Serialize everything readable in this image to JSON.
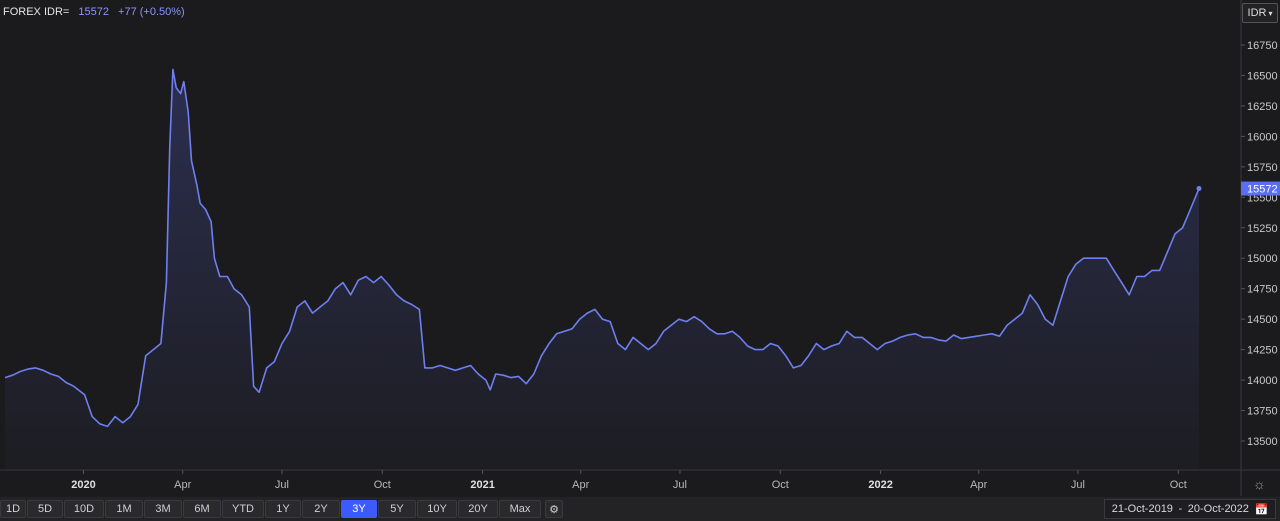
{
  "header": {
    "symbol": "FOREX IDR=",
    "price": "15572",
    "change": "+77 (+0.50%)",
    "currency": "IDR"
  },
  "colors": {
    "line": "#6e7ff0",
    "area_top": "#3a3f7a",
    "active": "#3d5afe"
  },
  "ranges": [
    "1D",
    "5D",
    "10D",
    "1M",
    "3M",
    "6M",
    "YTD",
    "1Y",
    "2Y",
    "3Y",
    "5Y",
    "10Y",
    "20Y",
    "Max"
  ],
  "active_range": "3Y",
  "date_range": {
    "start": "21-Oct-2019",
    "sep": "-",
    "end": "20-Oct-2022"
  },
  "icons": {
    "settings": "gear-icon",
    "calendar": "calendar-icon",
    "chart_settings": "sun-gear-icon"
  },
  "chart_data": {
    "type": "area",
    "title": "",
    "xlabel": "",
    "ylabel": "",
    "y_ticks": [
      13500,
      13750,
      14000,
      14250,
      14500,
      14750,
      15000,
      15250,
      15500,
      15750,
      16000,
      16250,
      16500,
      16750
    ],
    "y_range": [
      13300,
      16800
    ],
    "x_range": [
      "2019-10-21",
      "2022-10-20"
    ],
    "x_ticks": [
      {
        "date": "2020-01-01",
        "label": "2020",
        "major": true
      },
      {
        "date": "2020-04-01",
        "label": "Apr",
        "major": false
      },
      {
        "date": "2020-07-01",
        "label": "Jul",
        "major": false
      },
      {
        "date": "2020-10-01",
        "label": "Oct",
        "major": false
      },
      {
        "date": "2021-01-01",
        "label": "2021",
        "major": true
      },
      {
        "date": "2021-04-01",
        "label": "Apr",
        "major": false
      },
      {
        "date": "2021-07-01",
        "label": "Jul",
        "major": false
      },
      {
        "date": "2021-10-01",
        "label": "Oct",
        "major": false
      },
      {
        "date": "2022-01-01",
        "label": "2022",
        "major": true
      },
      {
        "date": "2022-04-01",
        "label": "Apr",
        "major": false
      },
      {
        "date": "2022-07-01",
        "label": "Jul",
        "major": false
      },
      {
        "date": "2022-10-01",
        "label": "Oct",
        "major": false
      }
    ],
    "last_value_label": "15572",
    "series": [
      {
        "values": [
          [
            "2019-10-21",
            14020
          ],
          [
            "2019-10-28",
            14040
          ],
          [
            "2019-11-04",
            14070
          ],
          [
            "2019-11-11",
            14090
          ],
          [
            "2019-11-18",
            14100
          ],
          [
            "2019-11-25",
            14080
          ],
          [
            "2019-12-02",
            14050
          ],
          [
            "2019-12-09",
            14030
          ],
          [
            "2019-12-16",
            13980
          ],
          [
            "2019-12-23",
            13950
          ],
          [
            "2020-01-02",
            13880
          ],
          [
            "2020-01-09",
            13700
          ],
          [
            "2020-01-16",
            13640
          ],
          [
            "2020-01-23",
            13620
          ],
          [
            "2020-01-30",
            13700
          ],
          [
            "2020-02-06",
            13650
          ],
          [
            "2020-02-13",
            13700
          ],
          [
            "2020-02-20",
            13800
          ],
          [
            "2020-02-27",
            14200
          ],
          [
            "2020-03-05",
            14250
          ],
          [
            "2020-03-12",
            14300
          ],
          [
            "2020-03-17",
            14800
          ],
          [
            "2020-03-20",
            15900
          ],
          [
            "2020-03-23",
            16550
          ],
          [
            "2020-03-26",
            16400
          ],
          [
            "2020-03-30",
            16350
          ],
          [
            "2020-04-02",
            16450
          ],
          [
            "2020-04-06",
            16200
          ],
          [
            "2020-04-09",
            15800
          ],
          [
            "2020-04-14",
            15600
          ],
          [
            "2020-04-17",
            15450
          ],
          [
            "2020-04-22",
            15400
          ],
          [
            "2020-04-27",
            15300
          ],
          [
            "2020-04-30",
            15000
          ],
          [
            "2020-05-05",
            14850
          ],
          [
            "2020-05-12",
            14850
          ],
          [
            "2020-05-18",
            14750
          ],
          [
            "2020-05-25",
            14700
          ],
          [
            "2020-06-01",
            14600
          ],
          [
            "2020-06-05",
            13950
          ],
          [
            "2020-06-10",
            13900
          ],
          [
            "2020-06-17",
            14100
          ],
          [
            "2020-06-24",
            14150
          ],
          [
            "2020-07-01",
            14300
          ],
          [
            "2020-07-08",
            14400
          ],
          [
            "2020-07-15",
            14600
          ],
          [
            "2020-07-22",
            14650
          ],
          [
            "2020-07-29",
            14550
          ],
          [
            "2020-08-05",
            14600
          ],
          [
            "2020-08-12",
            14650
          ],
          [
            "2020-08-19",
            14750
          ],
          [
            "2020-08-26",
            14800
          ],
          [
            "2020-09-02",
            14700
          ],
          [
            "2020-09-09",
            14820
          ],
          [
            "2020-09-16",
            14850
          ],
          [
            "2020-09-23",
            14800
          ],
          [
            "2020-09-30",
            14850
          ],
          [
            "2020-10-07",
            14780
          ],
          [
            "2020-10-14",
            14700
          ],
          [
            "2020-10-21",
            14650
          ],
          [
            "2020-10-28",
            14620
          ],
          [
            "2020-11-04",
            14580
          ],
          [
            "2020-11-09",
            14100
          ],
          [
            "2020-11-16",
            14100
          ],
          [
            "2020-11-23",
            14120
          ],
          [
            "2020-11-30",
            14100
          ],
          [
            "2020-12-07",
            14080
          ],
          [
            "2020-12-14",
            14100
          ],
          [
            "2020-12-21",
            14120
          ],
          [
            "2020-12-28",
            14050
          ],
          [
            "2021-01-04",
            14000
          ],
          [
            "2021-01-08",
            13920
          ],
          [
            "2021-01-13",
            14050
          ],
          [
            "2021-01-20",
            14040
          ],
          [
            "2021-01-27",
            14020
          ],
          [
            "2021-02-03",
            14030
          ],
          [
            "2021-02-10",
            13970
          ],
          [
            "2021-02-17",
            14050
          ],
          [
            "2021-02-24",
            14200
          ],
          [
            "2021-03-03",
            14300
          ],
          [
            "2021-03-10",
            14380
          ],
          [
            "2021-03-17",
            14400
          ],
          [
            "2021-03-24",
            14420
          ],
          [
            "2021-03-31",
            14500
          ],
          [
            "2021-04-07",
            14550
          ],
          [
            "2021-04-14",
            14580
          ],
          [
            "2021-04-21",
            14500
          ],
          [
            "2021-04-28",
            14480
          ],
          [
            "2021-05-05",
            14300
          ],
          [
            "2021-05-12",
            14250
          ],
          [
            "2021-05-19",
            14350
          ],
          [
            "2021-05-26",
            14300
          ],
          [
            "2021-06-02",
            14250
          ],
          [
            "2021-06-09",
            14300
          ],
          [
            "2021-06-16",
            14400
          ],
          [
            "2021-06-23",
            14450
          ],
          [
            "2021-06-30",
            14500
          ],
          [
            "2021-07-07",
            14480
          ],
          [
            "2021-07-14",
            14520
          ],
          [
            "2021-07-21",
            14480
          ],
          [
            "2021-07-28",
            14420
          ],
          [
            "2021-08-04",
            14380
          ],
          [
            "2021-08-11",
            14380
          ],
          [
            "2021-08-18",
            14400
          ],
          [
            "2021-08-25",
            14350
          ],
          [
            "2021-09-01",
            14280
          ],
          [
            "2021-09-08",
            14250
          ],
          [
            "2021-09-15",
            14250
          ],
          [
            "2021-09-22",
            14300
          ],
          [
            "2021-09-29",
            14280
          ],
          [
            "2021-10-06",
            14200
          ],
          [
            "2021-10-13",
            14100
          ],
          [
            "2021-10-20",
            14120
          ],
          [
            "2021-10-27",
            14200
          ],
          [
            "2021-11-03",
            14300
          ],
          [
            "2021-11-10",
            14250
          ],
          [
            "2021-11-17",
            14280
          ],
          [
            "2021-11-24",
            14300
          ],
          [
            "2021-12-01",
            14400
          ],
          [
            "2021-12-08",
            14350
          ],
          [
            "2021-12-15",
            14350
          ],
          [
            "2021-12-22",
            14300
          ],
          [
            "2021-12-29",
            14250
          ],
          [
            "2022-01-05",
            14300
          ],
          [
            "2022-01-12",
            14320
          ],
          [
            "2022-01-19",
            14350
          ],
          [
            "2022-01-26",
            14370
          ],
          [
            "2022-02-02",
            14380
          ],
          [
            "2022-02-09",
            14350
          ],
          [
            "2022-02-16",
            14350
          ],
          [
            "2022-02-23",
            14330
          ],
          [
            "2022-03-02",
            14320
          ],
          [
            "2022-03-09",
            14370
          ],
          [
            "2022-03-16",
            14340
          ],
          [
            "2022-03-23",
            14350
          ],
          [
            "2022-03-30",
            14360
          ],
          [
            "2022-04-06",
            14370
          ],
          [
            "2022-04-13",
            14380
          ],
          [
            "2022-04-20",
            14360
          ],
          [
            "2022-04-27",
            14450
          ],
          [
            "2022-05-04",
            14500
          ],
          [
            "2022-05-11",
            14550
          ],
          [
            "2022-05-18",
            14700
          ],
          [
            "2022-05-25",
            14620
          ],
          [
            "2022-06-01",
            14500
          ],
          [
            "2022-06-08",
            14450
          ],
          [
            "2022-06-15",
            14650
          ],
          [
            "2022-06-22",
            14850
          ],
          [
            "2022-06-29",
            14950
          ],
          [
            "2022-07-06",
            15000
          ],
          [
            "2022-07-13",
            15000
          ],
          [
            "2022-07-20",
            15000
          ],
          [
            "2022-07-27",
            15000
          ],
          [
            "2022-08-03",
            14900
          ],
          [
            "2022-08-10",
            14800
          ],
          [
            "2022-08-17",
            14700
          ],
          [
            "2022-08-24",
            14850
          ],
          [
            "2022-08-31",
            14850
          ],
          [
            "2022-09-07",
            14900
          ],
          [
            "2022-09-14",
            14900
          ],
          [
            "2022-09-21",
            15050
          ],
          [
            "2022-09-28",
            15200
          ],
          [
            "2022-10-05",
            15250
          ],
          [
            "2022-10-12",
            15400
          ],
          [
            "2022-10-20",
            15572
          ]
        ]
      }
    ]
  }
}
